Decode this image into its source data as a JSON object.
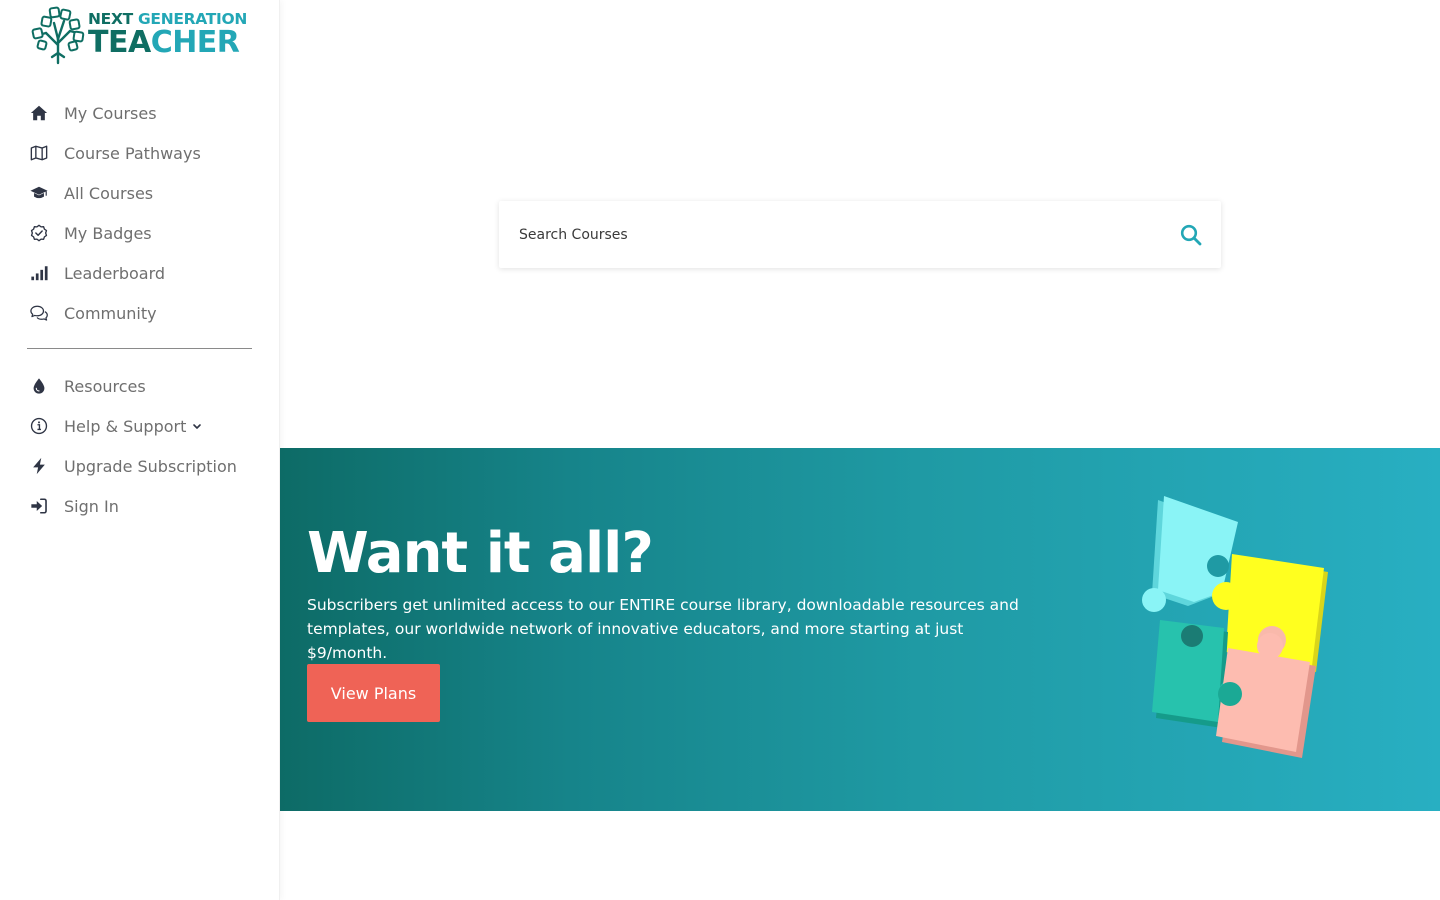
{
  "brand": {
    "line1_part1": "NEXT ",
    "line1_part2": "GENERATION",
    "line2_part1": "TEA",
    "line2_part2": "CHER"
  },
  "sidebar": {
    "primary": [
      {
        "label": "My Courses",
        "icon": "home-icon"
      },
      {
        "label": "Course Pathways",
        "icon": "map-icon"
      },
      {
        "label": "All Courses",
        "icon": "graduation-cap-icon"
      },
      {
        "label": "My Badges",
        "icon": "check-badge-icon"
      },
      {
        "label": "Leaderboard",
        "icon": "signal-bars-icon"
      },
      {
        "label": "Community",
        "icon": "chat-bubbles-icon"
      }
    ],
    "secondary": [
      {
        "label": "Resources",
        "icon": "droplet-icon"
      },
      {
        "label": "Help & Support",
        "icon": "info-icon"
      },
      {
        "label": "Upgrade Subscription",
        "icon": "lightning-icon"
      },
      {
        "label": "Sign In",
        "icon": "sign-in-icon"
      }
    ]
  },
  "search": {
    "placeholder": "Search Courses"
  },
  "promo": {
    "title": "Want it all?",
    "text": "Subscribers get unlimited access to our ENTIRE course library, downloadable resources and templates, our worldwide network of innovative educators, and more starting at just $9/month.",
    "button": "View Plans"
  },
  "colors": {
    "brand_dark": "#0f6e63",
    "brand_light": "#23a7b6",
    "accent_button": "#ef6356"
  }
}
